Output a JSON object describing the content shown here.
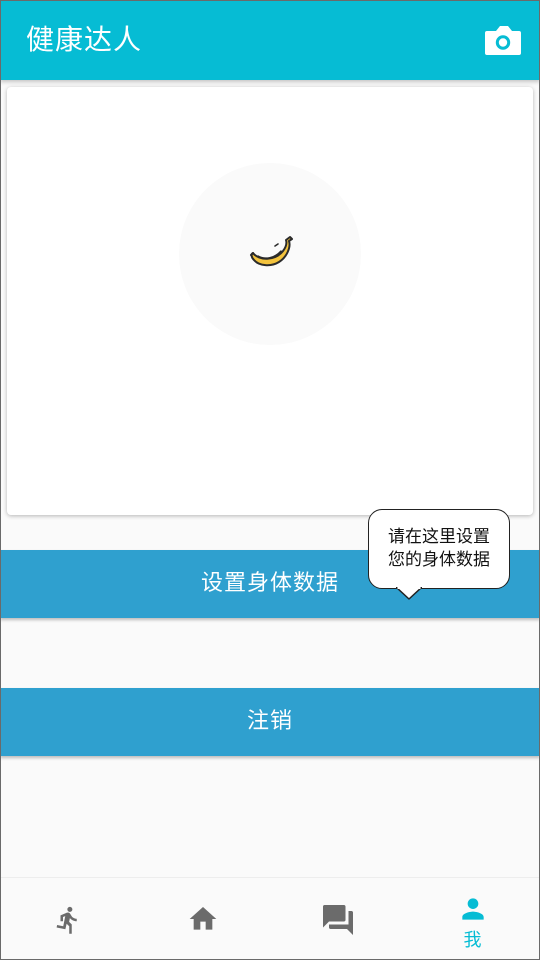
{
  "app": {
    "title": "健康达人",
    "camera_icon": "camera-icon",
    "accent_color": "#06bcd4",
    "button_color": "#2fa0cf"
  },
  "profile": {
    "avatar_icon": "banana-icon"
  },
  "actions": {
    "body_data_label": "设置身体数据",
    "logout_label": "注销"
  },
  "tooltip": {
    "line1": "请在这里设置",
    "line2": "您的身体数据"
  },
  "bottom_nav": {
    "items": [
      {
        "icon": "run-icon",
        "label": "",
        "active": false
      },
      {
        "icon": "home-icon",
        "label": "",
        "active": false
      },
      {
        "icon": "chat-icon",
        "label": "",
        "active": false
      },
      {
        "icon": "person-icon",
        "label": "我",
        "active": true
      }
    ]
  }
}
